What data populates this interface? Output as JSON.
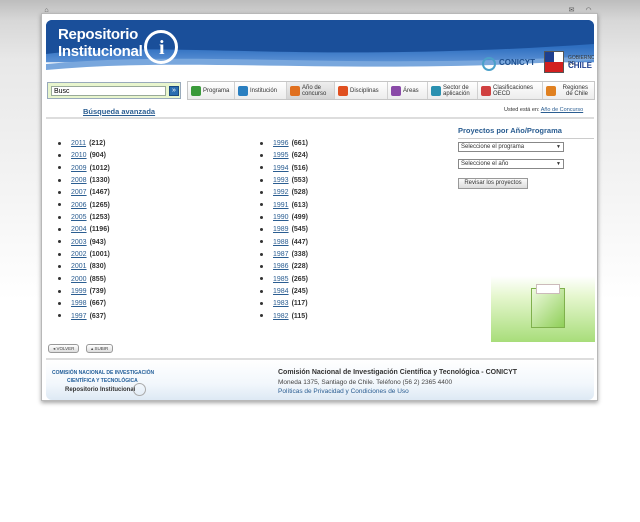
{
  "topbar": {
    "home_icon": "home-icon",
    "mail_icon": "mail-icon",
    "rss_icon": "rss-icon"
  },
  "header": {
    "title_line1": "Repositorio",
    "title_line2": "Institucional",
    "logo_glyph": "i",
    "conicyt": "CONICYT",
    "gob_text": "GOBIERNO DE",
    "gob_country": "CHILE"
  },
  "search": {
    "value": "Busc",
    "go_glyph": "»"
  },
  "nav": {
    "tabs": [
      {
        "label": "Programa",
        "color": "#3a9a3a"
      },
      {
        "label": "Institución",
        "color": "#2a7fc0"
      },
      {
        "label": "Año de concurso",
        "color": "#e07020"
      },
      {
        "label": "Disciplinas",
        "color": "#e05020"
      },
      {
        "label": "Áreas",
        "color": "#8a4aa8"
      },
      {
        "label": "Sector de aplicación",
        "color": "#2a90b0"
      },
      {
        "label": "Clasificaciones OECD",
        "color": "#d04040"
      },
      {
        "label": "Regiones de Chile",
        "color": "#e08020"
      }
    ]
  },
  "busqueda_avanzada": "Búsqueda avanzada",
  "breadcrumb": {
    "prefix": "Usted está en:",
    "current": "Año de Concurso"
  },
  "years_left": [
    {
      "year": "2011",
      "count": "(212)"
    },
    {
      "year": "2010",
      "count": "(904)"
    },
    {
      "year": "2009",
      "count": "(1012)"
    },
    {
      "year": "2008",
      "count": "(1330)"
    },
    {
      "year": "2007",
      "count": "(1467)"
    },
    {
      "year": "2006",
      "count": "(1265)"
    },
    {
      "year": "2005",
      "count": "(1253)"
    },
    {
      "year": "2004",
      "count": "(1196)"
    },
    {
      "year": "2003",
      "count": "(943)"
    },
    {
      "year": "2002",
      "count": "(1001)"
    },
    {
      "year": "2001",
      "count": "(830)"
    },
    {
      "year": "2000",
      "count": "(855)"
    },
    {
      "year": "1999",
      "count": "(739)"
    },
    {
      "year": "1998",
      "count": "(667)"
    },
    {
      "year": "1997",
      "count": "(637)"
    }
  ],
  "years_right": [
    {
      "year": "1996",
      "count": "(661)"
    },
    {
      "year": "1995",
      "count": "(624)"
    },
    {
      "year": "1994",
      "count": "(516)"
    },
    {
      "year": "1993",
      "count": "(553)"
    },
    {
      "year": "1992",
      "count": "(528)"
    },
    {
      "year": "1991",
      "count": "(613)"
    },
    {
      "year": "1990",
      "count": "(499)"
    },
    {
      "year": "1989",
      "count": "(545)"
    },
    {
      "year": "1988",
      "count": "(447)"
    },
    {
      "year": "1987",
      "count": "(338)"
    },
    {
      "year": "1986",
      "count": "(228)"
    },
    {
      "year": "1985",
      "count": "(265)"
    },
    {
      "year": "1984",
      "count": "(245)"
    },
    {
      "year": "1983",
      "count": "(117)"
    },
    {
      "year": "1982",
      "count": "(115)"
    }
  ],
  "sidebar": {
    "title": "Proyectos por Año/Programa",
    "select_programa": "Seleccione el programa",
    "select_anio": "Seleccione el año",
    "revisar": "Revisar los proyectos"
  },
  "pager": {
    "volver": "◂ VOLVER",
    "subir": "▴ SUBIR"
  },
  "footer": {
    "org_line1": "COMISIÓN NACIONAL DE INVESTIGACIÓN",
    "org_line2": "CIENTÍFICA Y TECNOLÓGICA",
    "repo": "Repositorio Institucional",
    "title": "Comisión Nacional de Investigación Científica y Tecnológica - CONICYT",
    "address": "Moneda 1375, Santiago de Chile. Teléfono (56 2) 2365 4400",
    "links": "Políticas de Privacidad y Condiciones de Uso"
  }
}
